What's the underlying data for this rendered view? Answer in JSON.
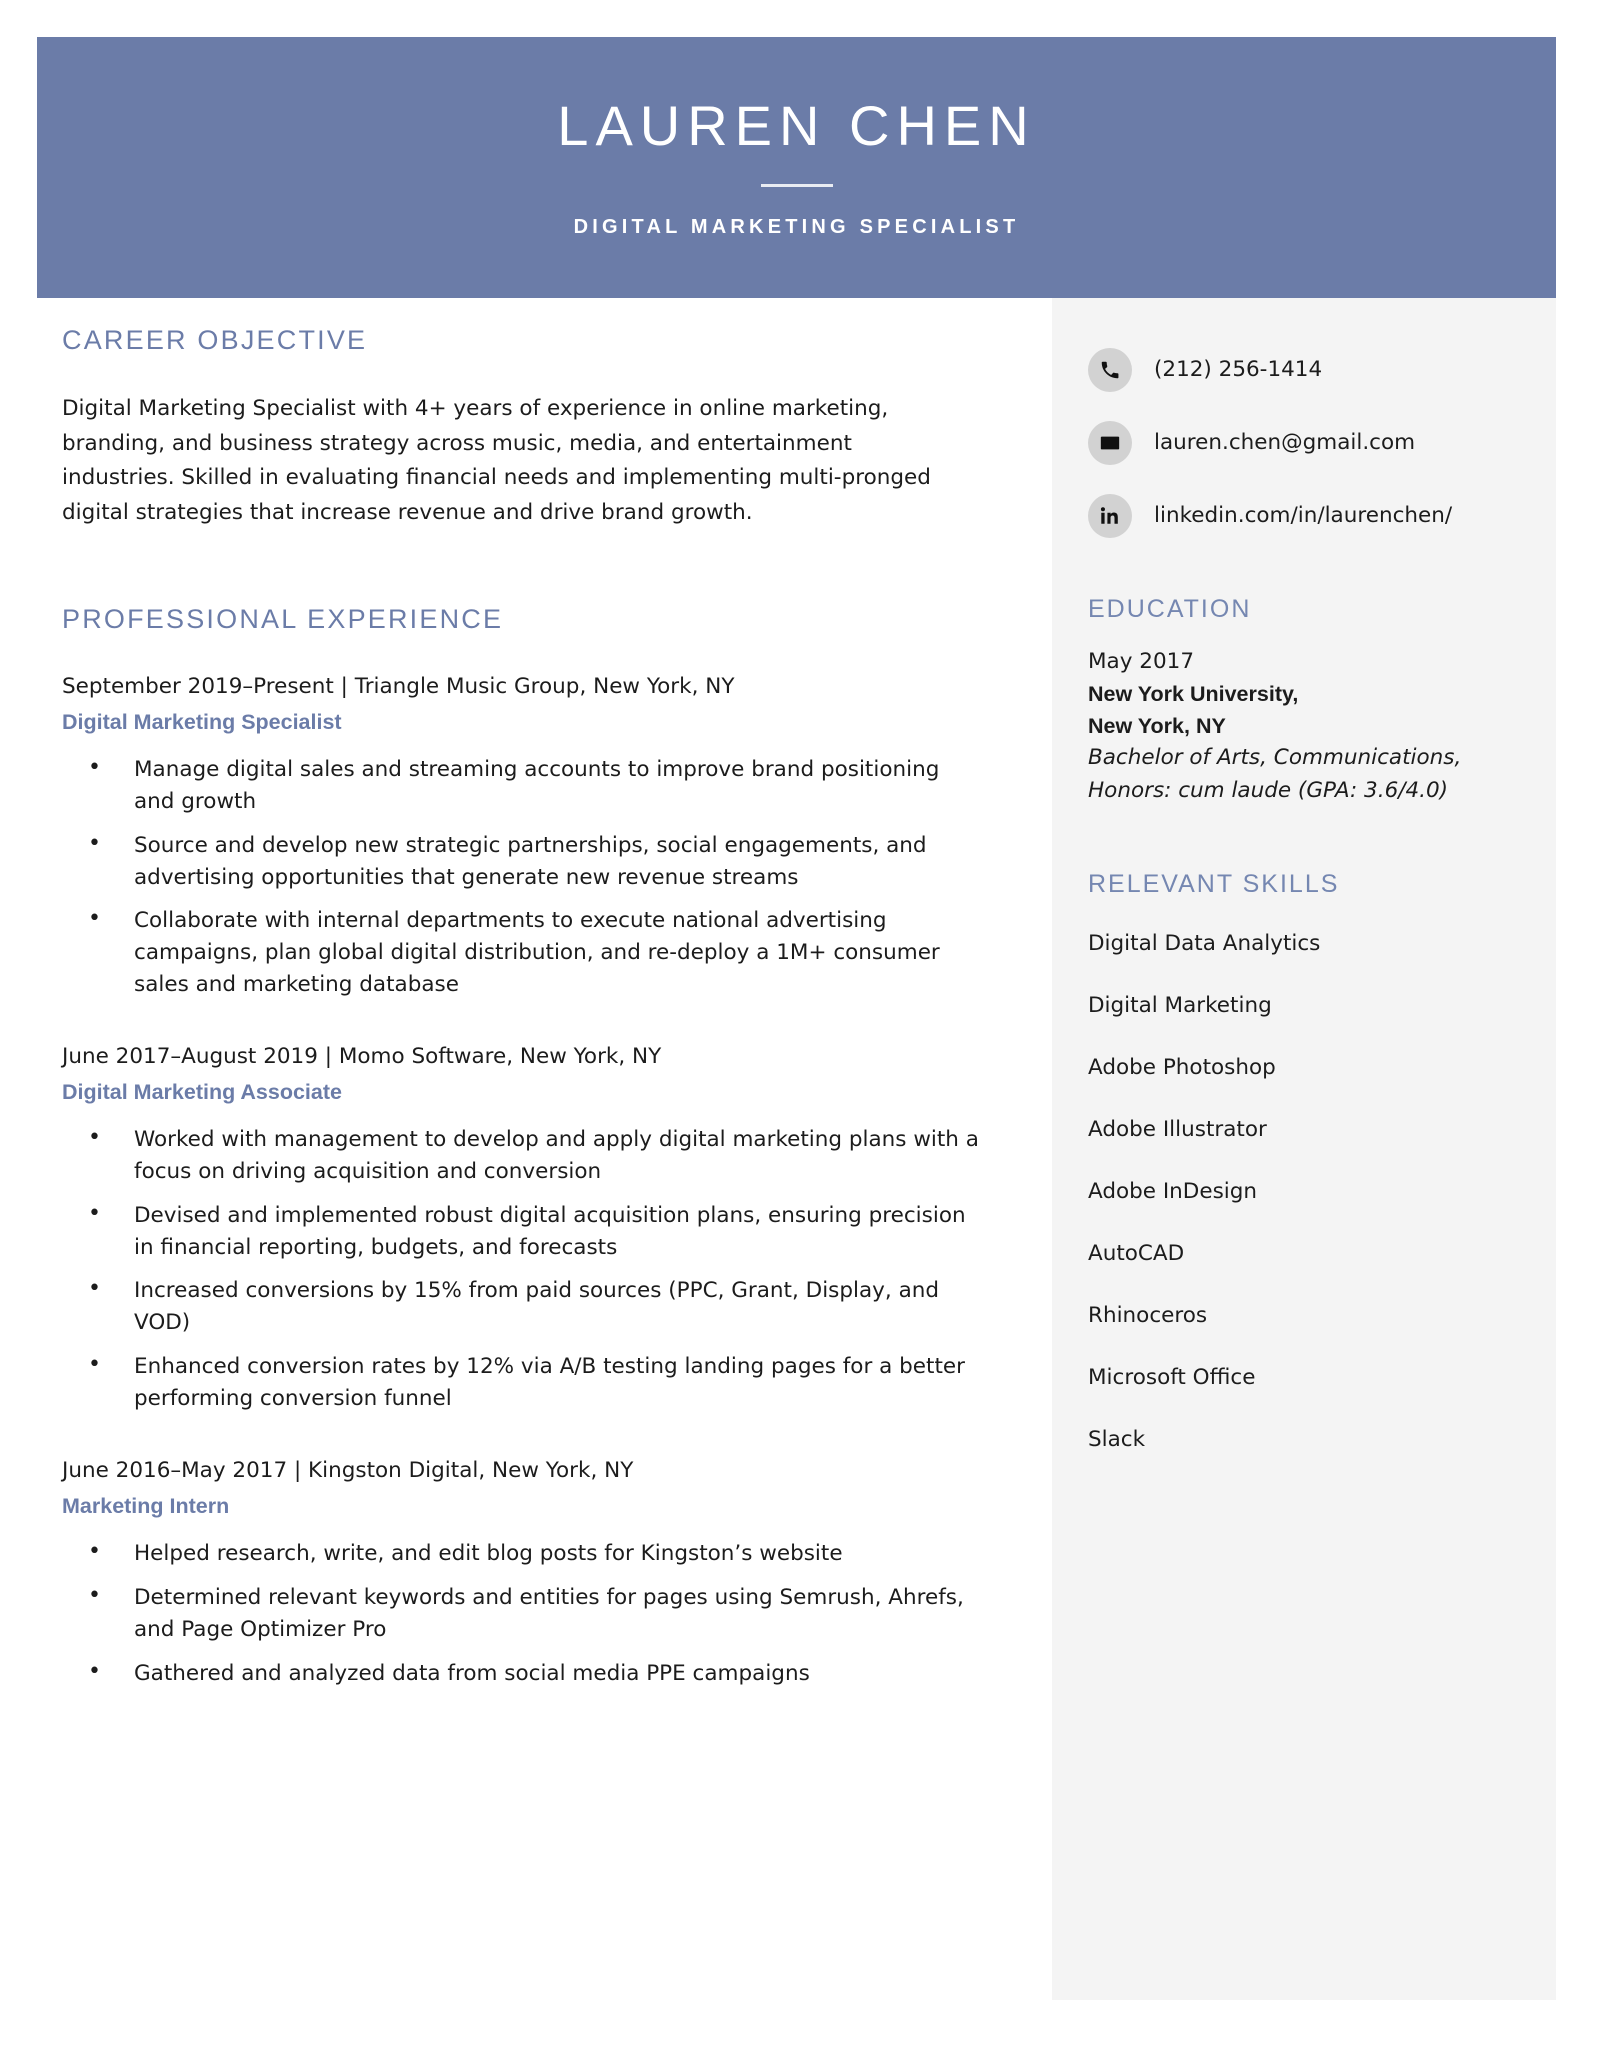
{
  "header": {
    "name": "LAUREN CHEN",
    "title": "DIGITAL MARKETING SPECIALIST",
    "accent_color": "#6b7ca8"
  },
  "main": {
    "objective": {
      "heading": "CAREER OBJECTIVE",
      "text": "Digital Marketing Specialist with 4+ years of experience in online marketing, branding, and business strategy across music, media, and entertainment industries. Skilled in evaluating financial needs and implementing multi-pronged digital strategies that increase revenue and drive brand growth."
    },
    "experience": {
      "heading": "PROFESSIONAL EXPERIENCE",
      "jobs": [
        {
          "meta": "September 2019–Present | Triangle Music Group, New York, NY",
          "title": "Digital Marketing Specialist",
          "bullets": [
            "Manage digital sales and streaming accounts to improve brand positioning and growth",
            "Source and develop new strategic partnerships, social engagements, and advertising opportunities that generate new revenue streams",
            "Collaborate with internal departments to execute national advertising campaigns, plan global digital distribution, and re-deploy a 1M+ consumer sales and marketing database"
          ]
        },
        {
          "meta": "June 2017–August 2019 | Momo Software, New York, NY",
          "title": "Digital Marketing Associate",
          "bullets": [
            "Worked with management to develop and apply digital marketing plans with a focus on driving acquisition and conversion",
            "Devised and implemented robust digital acquisition plans, ensuring precision in financial reporting, budgets, and forecasts",
            "Increased conversions by 15% from paid sources (PPC, Grant, Display, and VOD)",
            "Enhanced conversion rates by 12% via A/B testing landing pages for a better performing conversion funnel"
          ]
        },
        {
          "meta": "June 2016–May 2017 | Kingston Digital, New York, NY",
          "title": "Marketing Intern",
          "bullets": [
            "Helped research, write, and edit blog posts for Kingston’s website",
            "Determined relevant keywords and entities for pages using Semrush, Ahrefs, and Page Optimizer Pro",
            "Gathered and analyzed data from social media PPE campaigns"
          ]
        }
      ]
    }
  },
  "sidebar": {
    "contacts": [
      {
        "icon": "phone-icon",
        "text": "(212) 256-1414"
      },
      {
        "icon": "email-icon",
        "text": "lauren.chen@gmail.com"
      },
      {
        "icon": "linkedin-icon",
        "text": "linkedin.com/in/laurenchen/"
      }
    ],
    "education": {
      "heading": "EDUCATION",
      "date": "May 2017",
      "school_line1": "New York University,",
      "school_line2": "New York, NY",
      "detail_line1": "Bachelor of Arts, Communications,",
      "detail_line2": "Honors: cum laude (GPA: 3.6/4.0)"
    },
    "skills": {
      "heading": "RELEVANT SKILLS",
      "items": [
        "Digital Data Analytics",
        "Digital Marketing",
        "Adobe Photoshop",
        "Adobe Illustrator",
        "Adobe InDesign",
        "AutoCAD",
        "Rhinoceros",
        "Microsoft Office",
        "Slack"
      ]
    }
  }
}
